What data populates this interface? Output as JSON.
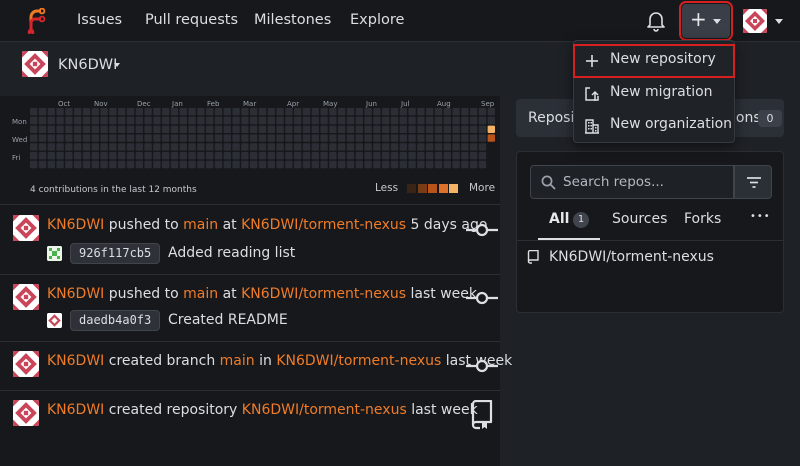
{
  "nav": {
    "links": [
      "Issues",
      "Pull requests",
      "Milestones",
      "Explore"
    ]
  },
  "create_menu": {
    "items": [
      {
        "label": "New repository",
        "icon": "plus-icon"
      },
      {
        "label": "New migration",
        "icon": "migration-icon"
      },
      {
        "label": "New organization",
        "icon": "organization-icon"
      }
    ]
  },
  "context": {
    "username": "KN6DWI"
  },
  "heatmap": {
    "months": [
      "Oct",
      "Nov",
      "Dec",
      "Jan",
      "Feb",
      "Mar",
      "Apr",
      "May",
      "Jun",
      "Jul",
      "Aug",
      "Sep"
    ],
    "days": [
      "Mon",
      "Wed",
      "Fri"
    ],
    "summary": "4 contributions in the last 12 months",
    "less": "Less",
    "more": "More",
    "legend_colors": [
      "#3a2416",
      "#7a3c14",
      "#b8531a",
      "#e0712a",
      "#f4b266"
    ]
  },
  "feed": [
    {
      "user": "KN6DWI",
      "action": "pushed to",
      "branch": "main",
      "prep": "at",
      "repo": "KN6DWI/torment-nexus",
      "when": "5 days ago",
      "sha": "926f117cb5",
      "message": "Added reading list"
    },
    {
      "user": "KN6DWI",
      "action": "pushed to",
      "branch": "main",
      "prep": "at",
      "repo": "KN6DWI/torment-nexus",
      "when": "last week",
      "sha": "daedb4a0f3",
      "message": "Created README"
    },
    {
      "user": "KN6DWI",
      "action": "created branch",
      "branch": "main",
      "prep": "in",
      "repo": "KN6DWI/torment-nexus",
      "when": "last week"
    },
    {
      "user": "KN6DWI",
      "action": "created repository",
      "repo": "KN6DWI/torment-nexus",
      "when": "last week"
    }
  ],
  "repo_panel": {
    "tab_partial": "Reposit",
    "tab_tail": "ions",
    "tab_count": "0",
    "search_placeholder": "Search repos...",
    "filters": [
      {
        "label": "All",
        "count": "1"
      },
      {
        "label": "Sources"
      },
      {
        "label": "Forks"
      }
    ],
    "more": "•••",
    "repos": [
      "KN6DWI/torment-nexus"
    ]
  },
  "colors": {
    "accent": "#f07c28",
    "highlight": "#d62020"
  }
}
